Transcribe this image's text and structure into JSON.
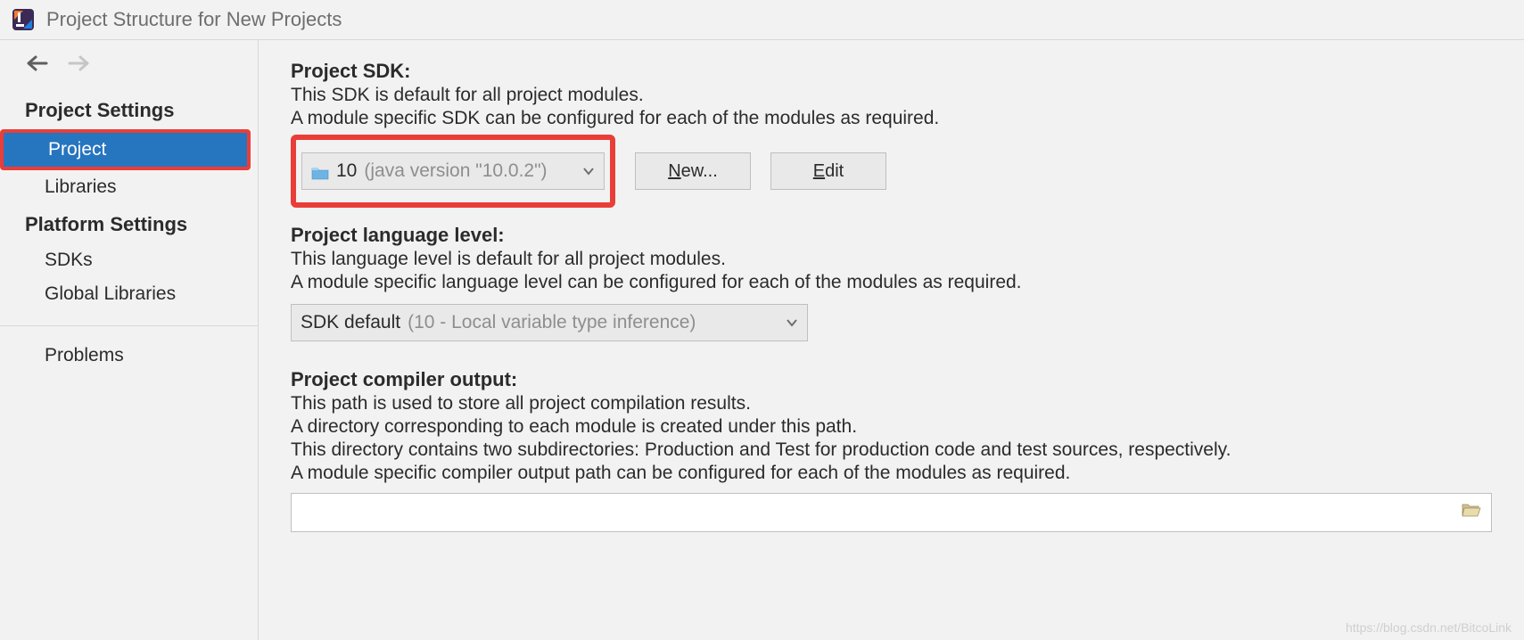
{
  "window": {
    "title": "Project Structure for New Projects"
  },
  "sidebar": {
    "section_project_settings": "Project Settings",
    "section_platform_settings": "Platform Settings",
    "items": {
      "project": "Project",
      "libraries": "Libraries",
      "sdks": "SDKs",
      "global_libraries": "Global Libraries",
      "problems": "Problems"
    }
  },
  "content": {
    "sdk_label": "Project SDK:",
    "sdk_desc1": "This SDK is default for all project modules.",
    "sdk_desc2": "A module specific SDK can be configured for each of the modules as required.",
    "sdk_combo_main": "10",
    "sdk_combo_sub": "(java version \"10.0.2\")",
    "new_btn": "New...",
    "edit_btn": "Edit",
    "lang_label": "Project language level:",
    "lang_desc1": "This language level is default for all project modules.",
    "lang_desc2": "A module specific language level can be configured for each of the modules as required.",
    "lang_combo_main": "SDK default",
    "lang_combo_sub": "(10 - Local variable type inference)",
    "out_label": "Project compiler output:",
    "out_desc1": "This path is used to store all project compilation results.",
    "out_desc2": "A directory corresponding to each module is created under this path.",
    "out_desc3": "This directory contains two subdirectories: Production and Test for production code and test sources, respectively.",
    "out_desc4": "A module specific compiler output path can be configured for each of the modules as required.",
    "out_value": ""
  },
  "watermark": "https://blog.csdn.net/BitcoLink"
}
